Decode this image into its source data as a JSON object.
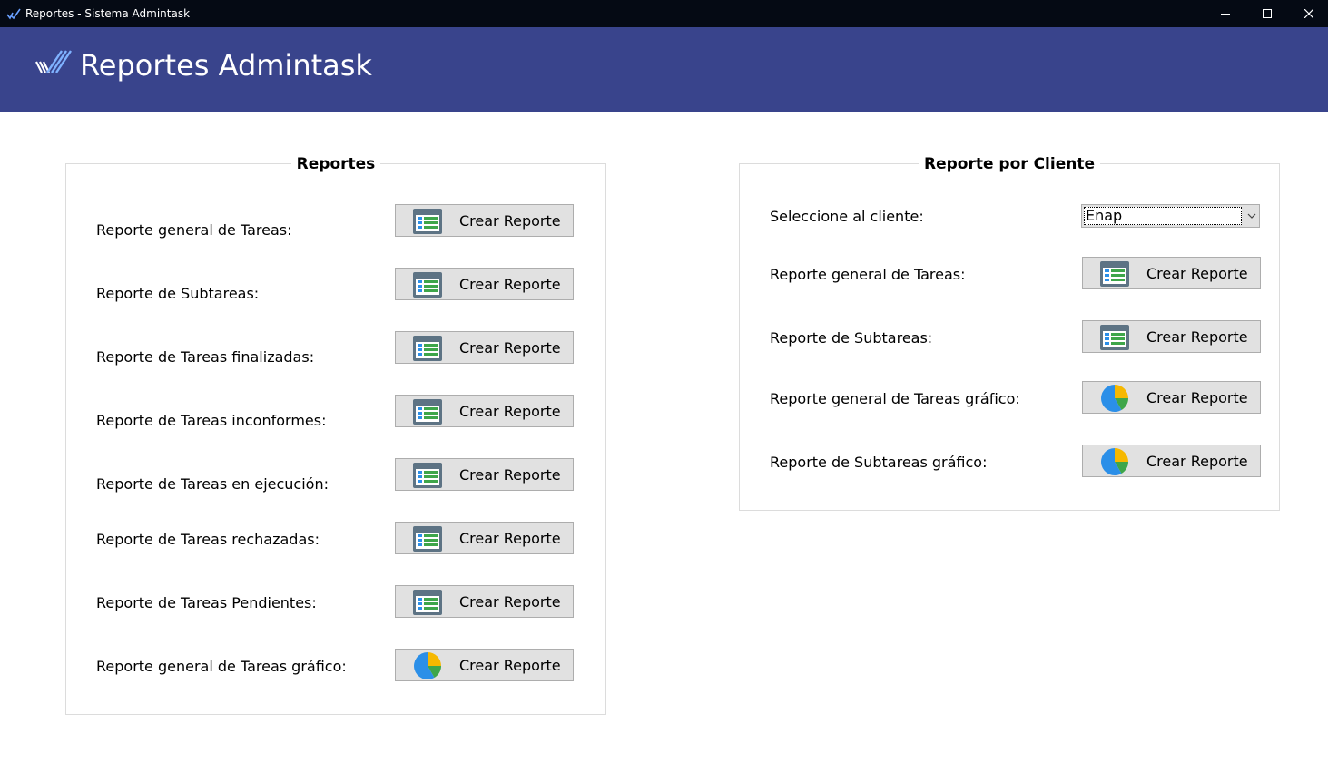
{
  "window": {
    "title": "Reportes - Sistema Admintask"
  },
  "header": {
    "title": "Reportes Admintask",
    "color": "#39448c"
  },
  "reportes": {
    "title": "Reportes",
    "rows": [
      {
        "label": "Reporte general de Tareas:",
        "button": "Crear Reporte",
        "icon": "table-icon"
      },
      {
        "label": "Reporte de Subtareas:",
        "button": "Crear Reporte",
        "icon": "table-icon"
      },
      {
        "label": "Reporte de Tareas finalizadas:",
        "button": "Crear Reporte",
        "icon": "table-icon"
      },
      {
        "label": "Reporte de Tareas inconformes:",
        "button": "Crear Reporte",
        "icon": "table-icon"
      },
      {
        "label": "Reporte de Tareas en ejecución:",
        "button": "Crear Reporte",
        "icon": "table-icon"
      },
      {
        "label": "Reporte de Tareas rechazadas:",
        "button": "Crear Reporte",
        "icon": "table-icon"
      },
      {
        "label": "Reporte de Tareas Pendientes:",
        "button": "Crear Reporte",
        "icon": "table-icon"
      },
      {
        "label": "Reporte general de Tareas gráfico:",
        "button": "Crear Reporte",
        "icon": "pie-chart-icon"
      }
    ]
  },
  "cliente": {
    "title": "Reporte por Cliente",
    "select_label": "Seleccione al cliente:",
    "selected_client": "Enap",
    "rows": [
      {
        "label": "Reporte general de Tareas:",
        "button": "Crear Reporte",
        "icon": "table-icon"
      },
      {
        "label": "Reporte de Subtareas:",
        "button": "Crear Reporte",
        "icon": "table-icon"
      },
      {
        "label": "Reporte general de Tareas gráfico:",
        "button": "Crear Reporte",
        "icon": "pie-chart-icon"
      },
      {
        "label": "Reporte de Subtareas gráfico:",
        "button": "Crear Reporte",
        "icon": "pie-chart-icon"
      }
    ]
  }
}
